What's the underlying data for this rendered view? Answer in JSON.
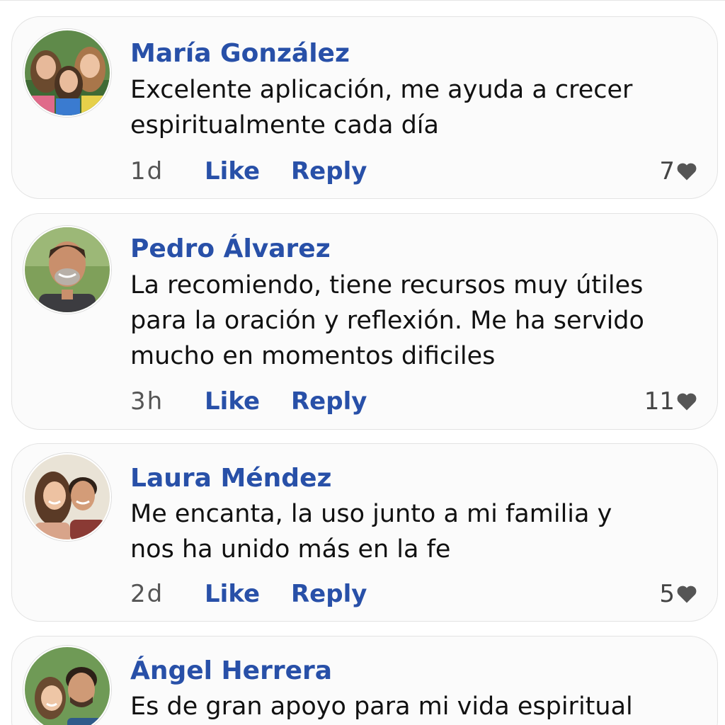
{
  "comments": [
    {
      "author": "María González",
      "text_lines": [
        "Excelente aplicación, me ayuda a crecer",
        "espiritualmente cada día"
      ],
      "time": "1d",
      "like_label": "Like",
      "reply_label": "Reply",
      "likes": "7",
      "avatar": "three-girls-photo"
    },
    {
      "author": "Pedro Álvarez",
      "text_lines": [
        "La recomiendo,  tiene recursos muy útiles",
        "para la oración y reflexión. Me ha servido",
        "mucho en momentos dificiles"
      ],
      "time": "3h",
      "like_label": "Like",
      "reply_label": "Reply",
      "likes": "11",
      "avatar": "bald-man-photo"
    },
    {
      "author": "Laura Méndez",
      "text_lines": [
        "Me encanta, la uso junto a mi familia y",
        "nos ha unido más en la fe"
      ],
      "time": "2d",
      "like_label": "Like",
      "reply_label": "Reply",
      "likes": "5",
      "avatar": "couple-photo"
    },
    {
      "author": "Ángel Herrera",
      "text_lines": [
        "Es de gran apoyo para mi vida espiritual"
      ],
      "time": "",
      "like_label": "",
      "reply_label": "",
      "likes": "",
      "avatar": "father-daughter-photo"
    }
  ],
  "icons": {
    "like_count": "heart-icon"
  },
  "colors": {
    "link": "#2850a8",
    "text": "#111111",
    "muted": "#555555",
    "card_bg": "#fbfbfb"
  }
}
